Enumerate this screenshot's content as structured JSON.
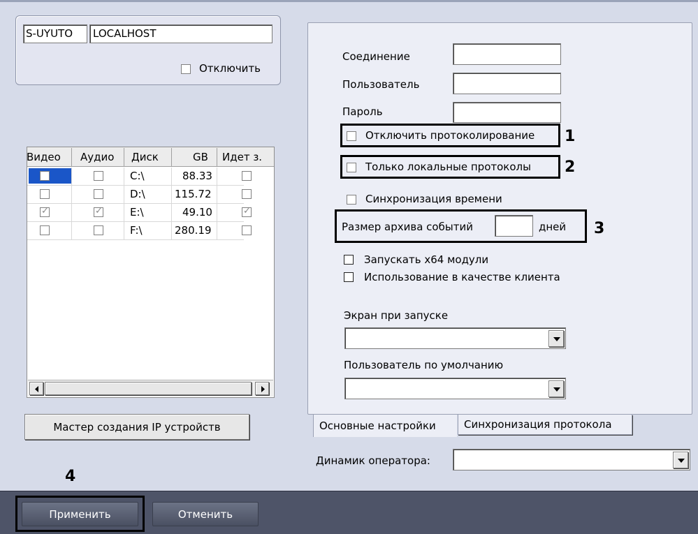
{
  "server_panel": {
    "id_field": "S-UYUTO",
    "host_field": "LOCALHOST",
    "disable_label": "Отключить"
  },
  "disk_table": {
    "columns": [
      "Видео",
      "Аудио",
      "Диск",
      "GB",
      "Идет з."
    ],
    "rows": [
      {
        "video": false,
        "audio": false,
        "disk": "C:\\",
        "gb": "88.33",
        "writing": false
      },
      {
        "video": false,
        "audio": false,
        "disk": "D:\\",
        "gb": "115.72",
        "writing": false
      },
      {
        "video": true,
        "audio": true,
        "disk": "E:\\",
        "gb": "49.10",
        "writing": true
      },
      {
        "video": false,
        "audio": false,
        "disk": "F:\\",
        "gb": "280.19",
        "writing": false
      }
    ]
  },
  "wizard_button_label": "Мастер создания IP устройств",
  "settings": {
    "connection_label": "Соединение",
    "user_label": "Пользователь",
    "password_label": "Пароль",
    "disable_logging_label": "Отключить протоколирование",
    "local_logs_label": "Только локальные протоколы",
    "time_sync_label": "Синхронизация времени",
    "archive_size_label": "Размер архива событий",
    "archive_size_unit": "дней",
    "run_x64_label": "Запускать x64 модули",
    "client_use_label": "Использование в качестве клиента",
    "startup_screen_label": "Экран при запуске",
    "default_user_label": "Пользователь по умолчанию"
  },
  "tabs": [
    "Основные настройки",
    "Синхронизация протокола"
  ],
  "operator_speaker_label": "Динамик оператора:",
  "markers": [
    "1",
    "2",
    "3",
    "4"
  ],
  "footer": {
    "apply_label": "Применить",
    "cancel_label": "Отменить"
  },
  "colors": {
    "background": "#d6dbe9",
    "footer_bar": "#4e5468",
    "selection": "#1a56c8"
  },
  "icons": {
    "dropdown": "triangle-down",
    "scroll_left": "triangle-left",
    "scroll_right": "triangle-right"
  }
}
